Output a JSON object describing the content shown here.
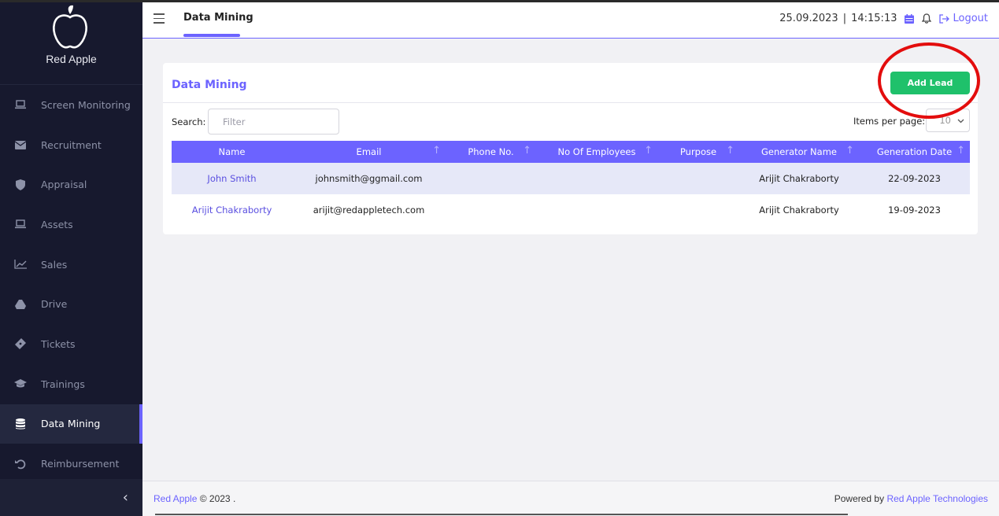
{
  "brand": {
    "name": "Red Apple"
  },
  "sidebar": {
    "items": [
      {
        "label": "Screen Monitoring",
        "icon": "laptop-icon"
      },
      {
        "label": "Recruitment",
        "icon": "envelope-icon"
      },
      {
        "label": "Appraisal",
        "icon": "shield-icon"
      },
      {
        "label": "Assets",
        "icon": "laptop-icon"
      },
      {
        "label": "Sales",
        "icon": "chart-line-icon"
      },
      {
        "label": "Drive",
        "icon": "drive-icon"
      },
      {
        "label": "Tickets",
        "icon": "ticket-icon"
      },
      {
        "label": "Trainings",
        "icon": "graduation-cap-icon"
      },
      {
        "label": "Data Mining",
        "icon": "database-icon",
        "active": true
      },
      {
        "label": "Reimbursement",
        "icon": "undo-icon"
      }
    ]
  },
  "header": {
    "title": "Data Mining",
    "date": "25.09.2023",
    "separator": "|",
    "time": "14:15:13",
    "logout_label": "Logout"
  },
  "card": {
    "title": "Data Mining",
    "add_button_label": "Add Lead",
    "search_label": "Search:",
    "search_placeholder": "Filter",
    "items_per_page_label": "Items per page:",
    "items_per_page_value": "10"
  },
  "table": {
    "columns": [
      "Name",
      "Email",
      "Phone No.",
      "No Of Employees",
      "Purpose",
      "Generator Name",
      "Generation Date"
    ],
    "rows": [
      {
        "name": "John  Smith",
        "email": "johnsmith@ggmail.com",
        "phone": "",
        "employees": "",
        "purpose": "",
        "generator": "Arijit Chakraborty",
        "date": "22-09-2023"
      },
      {
        "name": "Arijit  Chakraborty",
        "email": "arijit@redappletech.com",
        "phone": "",
        "employees": "",
        "purpose": "",
        "generator": "Arijit Chakraborty",
        "date": "19-09-2023"
      }
    ]
  },
  "footer": {
    "brand": "Red Apple",
    "copyright": "© 2023 .",
    "powered_by": "Powered by",
    "company": "Red Apple Technologies"
  },
  "colors": {
    "accent": "#6c63ff",
    "sidebar_bg": "#17192e",
    "add_button": "#1fc16b",
    "annotation": "#e30d0d"
  }
}
